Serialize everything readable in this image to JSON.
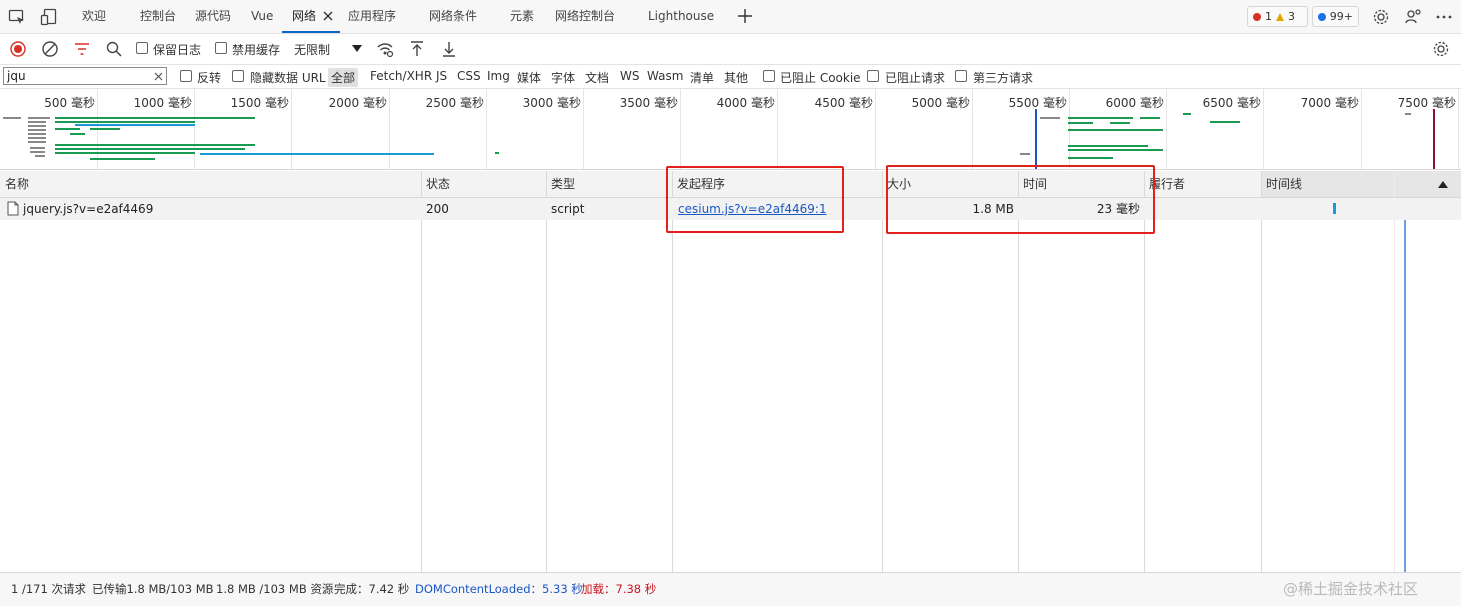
{
  "tabs": {
    "welcome": "欢迎",
    "console": "控制台",
    "sources": "源代码",
    "vue": "Vue",
    "network": "网络",
    "application": "应用程序",
    "network_conditions": "网络条件",
    "elements": "元素",
    "network_console": "网络控制台",
    "lighthouse": "Lighthouse"
  },
  "badges": {
    "errors": "1",
    "warnings": "3",
    "issues": "99+"
  },
  "toolbar": {
    "preserve_log": "保留日志",
    "disable_cache": "禁用缓存",
    "throttling": "无限制"
  },
  "filter": {
    "search_value": "jqu",
    "invert": "反转",
    "hide_data_urls": "隐藏数据 URL",
    "types": [
      "全部",
      "Fetch/XHR",
      "JS",
      "CSS",
      "Img",
      "媒体",
      "字体",
      "文档",
      "WS",
      "Wasm",
      "清单",
      "其他"
    ],
    "blocked_cookies": "已阻止 Cookie",
    "blocked_requests": "已阻止请求",
    "third_party": "第三方请求"
  },
  "overview": {
    "ticks": [
      "500 毫秒",
      "1000 毫秒",
      "1500 毫秒",
      "2000 毫秒",
      "2500 毫秒",
      "3000 毫秒",
      "3500 毫秒",
      "4000 毫秒",
      "4500 毫秒",
      "5000 毫秒",
      "5500 毫秒",
      "6000 毫秒",
      "6500 毫秒",
      "7000 毫秒",
      "7500 毫秒"
    ]
  },
  "table": {
    "headers": {
      "name": "名称",
      "status": "状态",
      "type": "类型",
      "initiator": "发起程序",
      "size": "大小",
      "time": "时间",
      "fulfilled_by": "履行者",
      "waterfall": "时间线"
    },
    "rows": [
      {
        "name": "jquery.js?v=e2af4469",
        "status": "200",
        "type": "script",
        "initiator": "cesium.js?v=e2af4469:1",
        "size": "1.8 MB",
        "time": "23 毫秒"
      }
    ]
  },
  "status": {
    "requests": "1 /171 次请求",
    "transferred": "已传输1.8 MB/103 MB",
    "resources": "1.8 MB /103 MB 资源",
    "finish": "完成：7.42 秒",
    "dcl": "DOMContentLoaded：5.33 秒",
    "load": "加载：7.38 秒"
  },
  "watermark": "@稀土掘金技术社区",
  "colors": {
    "accent": "#0a67c8",
    "record_red": "#d93025",
    "dcl_blue": "#1a56c4",
    "load_red": "#c8161d",
    "highlight_box": "#e0211c",
    "bar_green": "#1a9b52",
    "bar_blue": "#1b9ad6"
  }
}
